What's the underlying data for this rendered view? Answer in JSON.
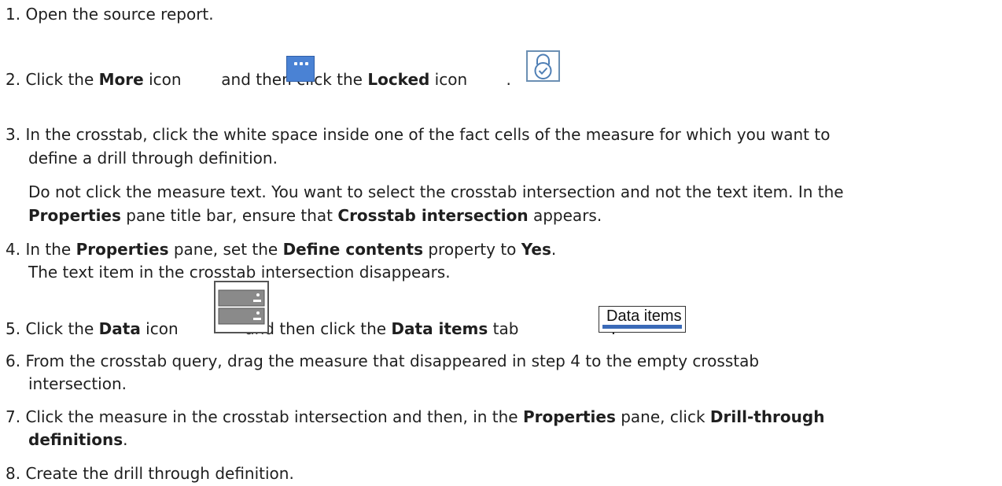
{
  "steps": [
    {
      "num": "1.",
      "text": "Open the source report."
    },
    {
      "num": "2.",
      "t1": "Click the ",
      "b1": "More",
      "t2": " icon ",
      "t3": " and then click the ",
      "b2": "Locked",
      "t4": " icon ",
      "t5": "."
    },
    {
      "num": "3.",
      "line1": "In the crosstab, click the white space inside one of the fact cells of the measure for which you want to",
      "line2": "define a drill through definition.",
      "note1": "Do not click the measure text. You want to select the crosstab intersection and not the text item. In the",
      "note2_b1": "Properties",
      "note2_t1": " pane title bar, ensure that ",
      "note2_b2": "Crosstab intersection",
      "note2_t2": " appears."
    },
    {
      "num": "4.",
      "t1": "In the ",
      "b1": "Properties",
      "t2": " pane, set the ",
      "b2": "Define contents",
      "t3": " property to ",
      "b3": "Yes",
      "t4": ".",
      "note": "The text item in the crosstab intersection disappears."
    },
    {
      "num": "5.",
      "t1": "Click the ",
      "b1": "Data",
      "t2": " icon ",
      "t3": " and then click the ",
      "b2": "Data items",
      "t4": " tab ",
      "t5": ".",
      "tab_image_label": "Data items"
    },
    {
      "num": "6.",
      "line1": "From the crosstab query, drag the measure that disappeared in step 4 to the empty crosstab",
      "line2": "intersection."
    },
    {
      "num": "7.",
      "t1": "Click the measure in the crosstab intersection and then, in the ",
      "b1": "Properties",
      "t2": " pane, click ",
      "b2": "Drill-through",
      "b3": "definitions",
      "t3": "."
    },
    {
      "num": "8.",
      "text": "Create the drill through definition."
    }
  ],
  "icons": [
    "more-icon",
    "locked-icon",
    "data-icon",
    "data-items-tab-icon"
  ]
}
